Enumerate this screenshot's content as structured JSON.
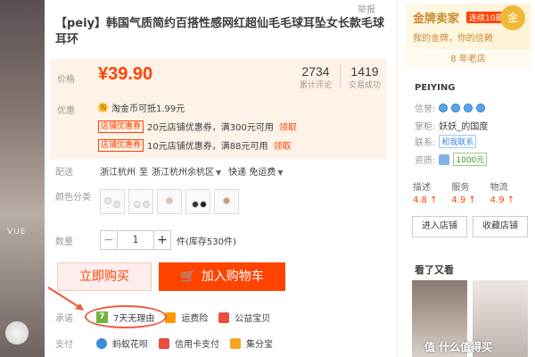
{
  "report": "举报",
  "product": {
    "title": "【peiy】韩国气质简约百搭性感网红超仙毛毛球耳坠女长款毛球耳环",
    "price_label": "价格",
    "price": "¥39.90",
    "reviews": {
      "num": "2734",
      "label": "累计评论"
    },
    "sales": {
      "num": "1419",
      "label": "交易成功"
    },
    "promo_label": "优惠",
    "tmall_coin": "淘金币可抵1.99元",
    "coupons": [
      {
        "tag": "店铺优惠券",
        "text": "20元店铺优惠券，满300元可用",
        "link": "领取"
      },
      {
        "tag": "店铺优惠券",
        "text": "10元店铺优惠券，满88元可用",
        "link": "领取"
      }
    ],
    "shipping": {
      "label": "配送",
      "from": "浙江杭州",
      "to_word": "至",
      "dest": "浙江杭州余杭区",
      "method": "快递 免运费"
    },
    "color": {
      "label": "颜色分类"
    },
    "quantity": {
      "label": "数量",
      "value": "1",
      "minus": "−",
      "plus": "+",
      "stock": "件(库存530件)"
    },
    "buy_now": "立即购买",
    "add_cart": "加入购物车",
    "promise": {
      "label": "承诺",
      "item1": "7天无理由",
      "item2": "运费险",
      "item3": "公益宝贝",
      "badge": "7"
    },
    "pay": {
      "label": "支付",
      "item1": "蚂蚁花呗",
      "item2": "信用卡支付",
      "item3": "集分宝"
    }
  },
  "left_image_text": "VUE",
  "seller": {
    "gold_title": "金牌卖家",
    "gold_tag": "连续10期",
    "gold_sub": "我的金牌，你的信赖",
    "medal": "金",
    "years": "8 年老店",
    "name": "PEIYING",
    "credit_label": "信誉:",
    "keeper_label": "掌柜:",
    "keeper": "妖妖_的国度",
    "contact_label": "联系:",
    "contact": "和我联系",
    "qual_label": "资质:",
    "qual": "1000元",
    "scores": [
      {
        "label": "描述",
        "value": "4.8",
        "arrow": "↑"
      },
      {
        "label": "服务",
        "value": "4.9",
        "arrow": "↑"
      },
      {
        "label": "物流",
        "value": "4.9",
        "arrow": "↑"
      }
    ],
    "enter_shop": "进入店铺",
    "fav_shop": "收藏店铺",
    "seen_title": "看了又看",
    "watermark": "值 什么值得买"
  }
}
